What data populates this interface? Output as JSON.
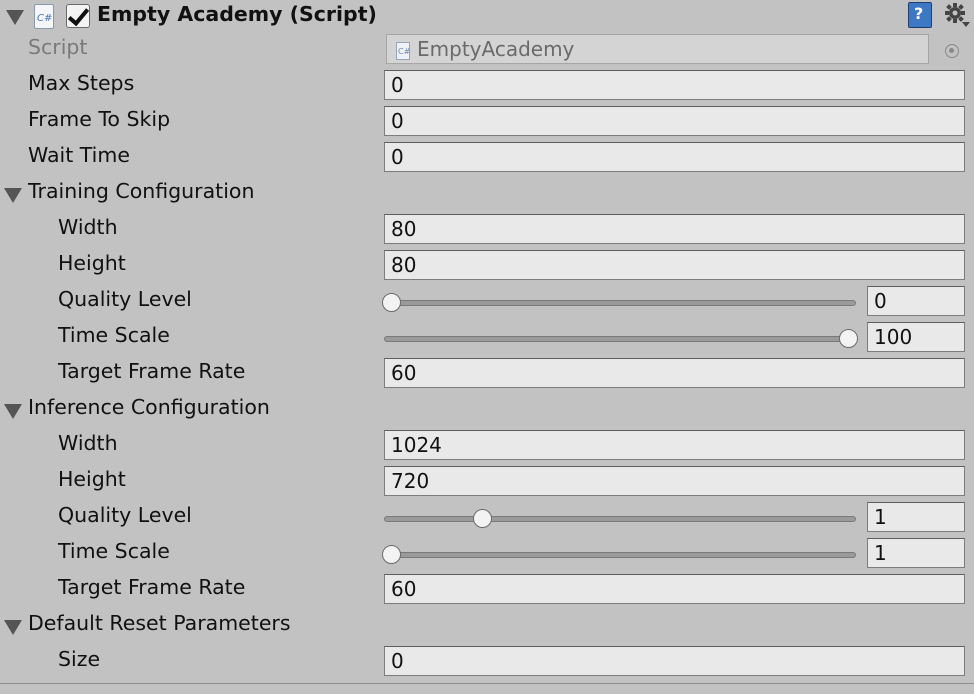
{
  "component": {
    "title": "Empty Academy (Script)",
    "enabled": true
  },
  "script_field": {
    "label": "Script",
    "value": "EmptyAcademy"
  },
  "fields": {
    "max_steps": {
      "label": "Max Steps",
      "value": "0"
    },
    "frame_to_skip": {
      "label": "Frame To Skip",
      "value": "0"
    },
    "wait_time": {
      "label": "Wait Time",
      "value": "0"
    }
  },
  "training": {
    "title": "Training Configuration",
    "width": {
      "label": "Width",
      "value": "80"
    },
    "height": {
      "label": "Height",
      "value": "80"
    },
    "quality_level": {
      "label": "Quality Level",
      "value": "0",
      "slider_fraction": 0.0
    },
    "time_scale": {
      "label": "Time Scale",
      "value": "100",
      "slider_fraction": 1.0
    },
    "target_frame_rate": {
      "label": "Target Frame Rate",
      "value": "60"
    }
  },
  "inference": {
    "title": "Inference Configuration",
    "width": {
      "label": "Width",
      "value": "1024"
    },
    "height": {
      "label": "Height",
      "value": "720"
    },
    "quality_level": {
      "label": "Quality Level",
      "value": "1",
      "slider_fraction": 0.2
    },
    "time_scale": {
      "label": "Time Scale",
      "value": "1",
      "slider_fraction": 0.0
    },
    "target_frame_rate": {
      "label": "Target Frame Rate",
      "value": "60"
    }
  },
  "reset_parameters": {
    "title": "Default Reset Parameters",
    "size": {
      "label": "Size",
      "value": "0"
    }
  },
  "icons": {
    "script_icon_text": "C#",
    "help_icon_text": "?"
  }
}
